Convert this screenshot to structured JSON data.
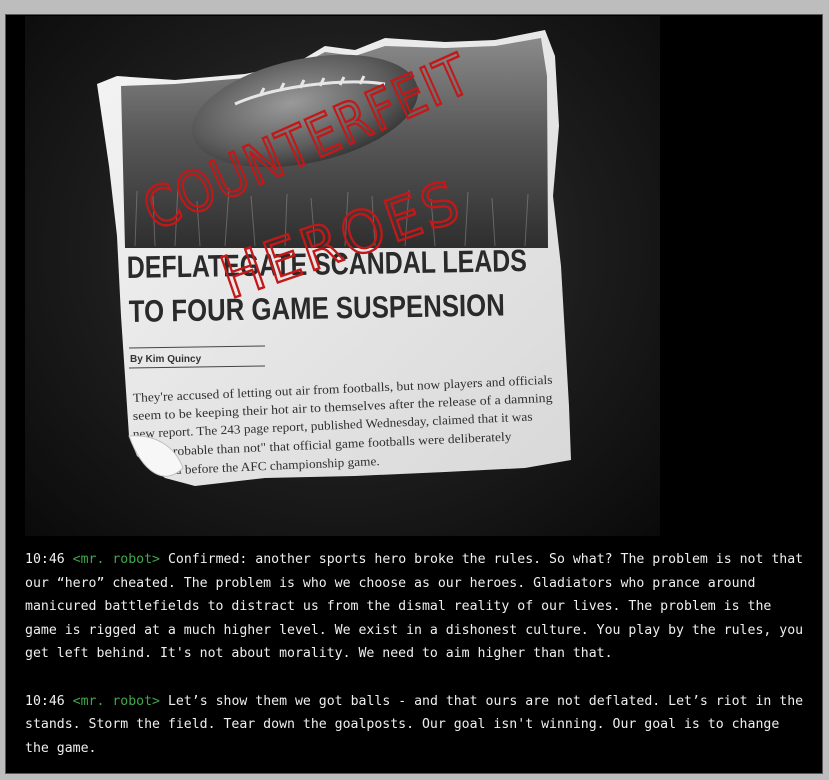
{
  "image": {
    "overlay_text_line1": "COUNTERFEIT",
    "overlay_text_line2": "HEROES",
    "headline_line1": "DEFLATEGATE SCANDAL LEADS",
    "headline_line2": "TO FOUR GAME SUSPENSION",
    "byline": "By Kim Quincy",
    "body_lines": [
      "They're accused of letting out air from footballs, but now players and officials",
      "seem to be keeping their hot air to themselves after the release of a damning",
      "new report. The 243 page report, published Wednesday, claimed that it was",
      "e probable than not\" that official game footballs were deliberately",
      "d before the AFC championship game."
    ],
    "overlay_color": "#c41818"
  },
  "messages": [
    {
      "time": "10:46",
      "nick": "<mr. robot>",
      "text": "Confirmed: another sports hero broke the rules. So what? The problem is not that our “hero” cheated. The problem is who we choose as our heroes. Gladiators who prance around manicured battlefields to distract us from the dismal reality of our lives. The problem is the game is rigged at a much higher level. We exist in a dishonest culture. You play by the rules, you get left behind. It's not about morality. We need to aim higher than that."
    },
    {
      "time": "10:46",
      "nick": "<mr. robot>",
      "text": "Let’s show them  we got balls - and that ours are not deflated. Let’s riot in the stands.  Storm the field. Tear down the goalposts. Our goal isn't winning. Our goal is to change the game."
    }
  ],
  "colors": {
    "nick": "#3ea84a",
    "text": "#efefef",
    "background": "#000000"
  }
}
